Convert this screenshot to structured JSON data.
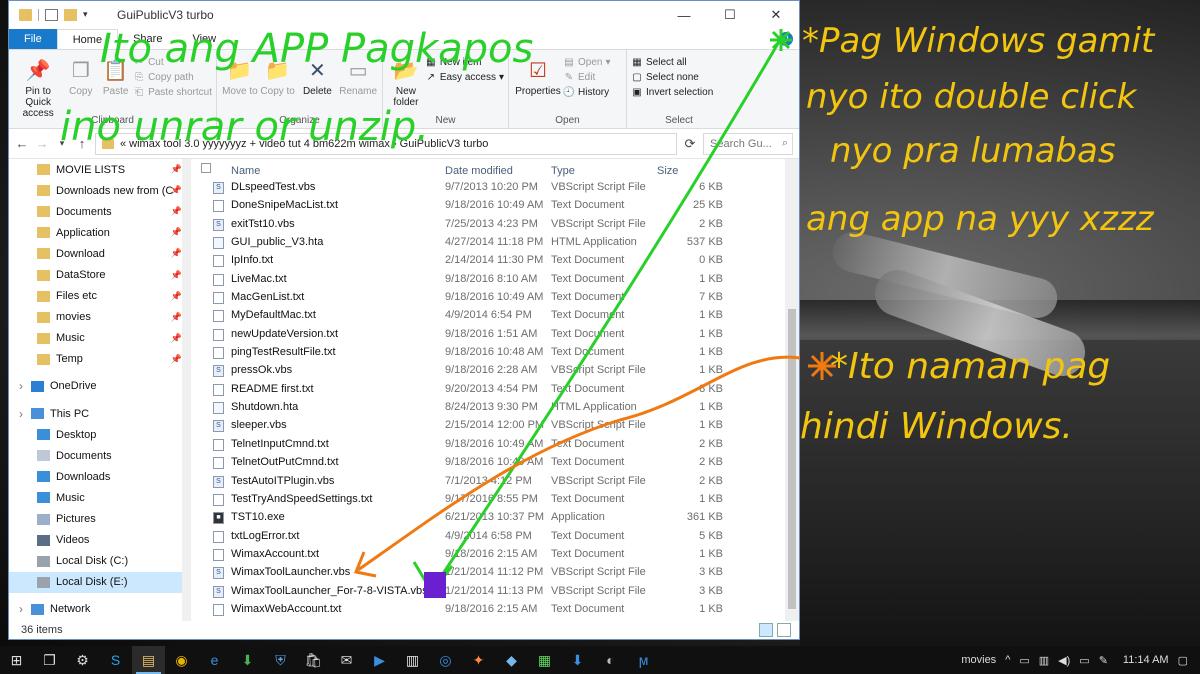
{
  "window": {
    "title": "GuiPublicV3 turbo",
    "controls": {
      "minimize": "—",
      "maximize": "☐",
      "close": "✕"
    }
  },
  "ribbon_tabs": [
    "File",
    "Home",
    "Share",
    "View"
  ],
  "ribbon": {
    "clipboard": {
      "label": "Clipboard",
      "pin": "Pin to Quick access",
      "copy": "Copy",
      "paste": "Paste",
      "cut": "Cut",
      "copy_path": "Copy path",
      "paste_shortcut": "Paste shortcut"
    },
    "organize": {
      "label": "Organize",
      "move_to": "Move to",
      "copy_to": "Copy to",
      "delete": "Delete",
      "rename": "Rename"
    },
    "new": {
      "label": "New",
      "new_item": "New item",
      "easy_access": "Easy access",
      "new_folder": "New folder"
    },
    "open": {
      "label": "Open",
      "properties": "Properties",
      "open": "Open",
      "edit": "Edit",
      "history": "History"
    },
    "select": {
      "label": "Select",
      "select_all": "Select all",
      "select_none": "Select none",
      "invert": "Invert selection"
    }
  },
  "address": {
    "path": "« wimax tool 3.0 yyyyyyyz + video tut 4 bm622m wimax › GuiPublicV3 turbo",
    "search_placeholder": "Search Gu..."
  },
  "nav": {
    "quick_access": [
      {
        "label": "MOVIE LISTS",
        "pinned": true
      },
      {
        "label": "Downloads new from (C",
        "pinned": true
      },
      {
        "label": "Documents",
        "pinned": true
      },
      {
        "label": "Application",
        "pinned": true
      },
      {
        "label": "Download",
        "pinned": true
      },
      {
        "label": "DataStore",
        "pinned": true
      },
      {
        "label": "Files etc",
        "pinned": true
      },
      {
        "label": "movies",
        "pinned": true
      },
      {
        "label": "Music",
        "pinned": true
      },
      {
        "label": "Temp",
        "pinned": true
      }
    ],
    "onedrive": "OneDrive",
    "this_pc": "This PC",
    "pc_items": [
      "Desktop",
      "Documents",
      "Downloads",
      "Music",
      "Pictures",
      "Videos",
      "Local Disk (C:)",
      "Local Disk (E:)"
    ],
    "network": "Network"
  },
  "columns": {
    "name": "Name",
    "date": "Date modified",
    "type": "Type",
    "size": "Size"
  },
  "files": [
    {
      "name": "DLspeedTest.vbs",
      "date": "9/7/2013 10:20 PM",
      "type": "VBScript Script File",
      "size": "6 KB",
      "kind": "vbs"
    },
    {
      "name": "DoneSnipeMacList.txt",
      "date": "9/18/2016 10:49 AM",
      "type": "Text Document",
      "size": "25 KB",
      "kind": "txt"
    },
    {
      "name": "exitTst10.vbs",
      "date": "7/25/2013 4:23 PM",
      "type": "VBScript Script File",
      "size": "2 KB",
      "kind": "vbs"
    },
    {
      "name": "GUI_public_V3.hta",
      "date": "4/27/2014 11:18 PM",
      "type": "HTML Application",
      "size": "537 KB",
      "kind": "hta"
    },
    {
      "name": "IpInfo.txt",
      "date": "2/14/2014 11:30 PM",
      "type": "Text Document",
      "size": "0 KB",
      "kind": "txt"
    },
    {
      "name": "LiveMac.txt",
      "date": "9/18/2016 8:10 AM",
      "type": "Text Document",
      "size": "1 KB",
      "kind": "txt"
    },
    {
      "name": "MacGenList.txt",
      "date": "9/18/2016 10:49 AM",
      "type": "Text Document",
      "size": "7 KB",
      "kind": "txt"
    },
    {
      "name": "MyDefaultMac.txt",
      "date": "4/9/2014 6:54 PM",
      "type": "Text Document",
      "size": "1 KB",
      "kind": "txt"
    },
    {
      "name": "newUpdateVersion.txt",
      "date": "9/18/2016 1:51 AM",
      "type": "Text Document",
      "size": "1 KB",
      "kind": "txt"
    },
    {
      "name": "pingTestResultFile.txt",
      "date": "9/18/2016 10:48 AM",
      "type": "Text Document",
      "size": "1 KB",
      "kind": "txt"
    },
    {
      "name": "pressOk.vbs",
      "date": "9/18/2016 2:28 AM",
      "type": "VBScript Script File",
      "size": "1 KB",
      "kind": "vbs"
    },
    {
      "name": "README first.txt",
      "date": "9/20/2013 4:54 PM",
      "type": "Text Document",
      "size": "8 KB",
      "kind": "txt"
    },
    {
      "name": "Shutdown.hta",
      "date": "8/24/2013 9:30 PM",
      "type": "HTML Application",
      "size": "1 KB",
      "kind": "hta"
    },
    {
      "name": "sleeper.vbs",
      "date": "2/15/2014 12:00 PM",
      "type": "VBScript Script File",
      "size": "1 KB",
      "kind": "vbs"
    },
    {
      "name": "TelnetInputCmnd.txt",
      "date": "9/18/2016 10:49 AM",
      "type": "Text Document",
      "size": "2 KB",
      "kind": "txt"
    },
    {
      "name": "TelnetOutPutCmnd.txt",
      "date": "9/18/2016 10:49 AM",
      "type": "Text Document",
      "size": "2 KB",
      "kind": "txt"
    },
    {
      "name": "TestAutoITPlugin.vbs",
      "date": "7/1/2013 4:12 PM",
      "type": "VBScript Script File",
      "size": "2 KB",
      "kind": "vbs"
    },
    {
      "name": "TestTryAndSpeedSettings.txt",
      "date": "9/17/2016 8:55 PM",
      "type": "Text Document",
      "size": "1 KB",
      "kind": "txt"
    },
    {
      "name": "TST10.exe",
      "date": "6/21/2013 10:37 PM",
      "type": "Application",
      "size": "361 KB",
      "kind": "exe"
    },
    {
      "name": "txtLogError.txt",
      "date": "4/9/2014 6:58 PM",
      "type": "Text Document",
      "size": "5 KB",
      "kind": "txt"
    },
    {
      "name": "WimaxAccount.txt",
      "date": "9/18/2016 2:15 AM",
      "type": "Text Document",
      "size": "1 KB",
      "kind": "txt"
    },
    {
      "name": "WimaxToolLauncher.vbs",
      "date": "1/21/2014 11:12 PM",
      "type": "VBScript Script File",
      "size": "3 KB",
      "kind": "vbs"
    },
    {
      "name": "WimaxToolLauncher_For-7-8-VISTA.vbs",
      "date": "1/21/2014 11:13 PM",
      "type": "VBScript Script File",
      "size": "3 KB",
      "kind": "vbs"
    },
    {
      "name": "WimaxWebAccount.txt",
      "date": "9/18/2016 2:15 AM",
      "type": "Text Document",
      "size": "1 KB",
      "kind": "txt"
    }
  ],
  "status": {
    "items": "36 items"
  },
  "taskbar": {
    "tray_label": "movies",
    "time": "11:14 AM"
  },
  "annotations": {
    "green_line1": "Ito ang APP Pagkapos",
    "green_line2": "ino unrar or unzip.",
    "yellow_right_1": "*Pag Windows gamit",
    "yellow_right_2": "nyo ito double click",
    "yellow_right_3": "nyo pra lumabas",
    "yellow_right_4": "ang app na yyy xzzz",
    "yellow_mid_1": "*Ito naman pag",
    "yellow_mid_2": "hindi Windows.",
    "colors": {
      "green": "#2ad02a",
      "yellow": "#f2c50f",
      "orange": "#f07a12",
      "purple": "#6a1fd0"
    }
  }
}
